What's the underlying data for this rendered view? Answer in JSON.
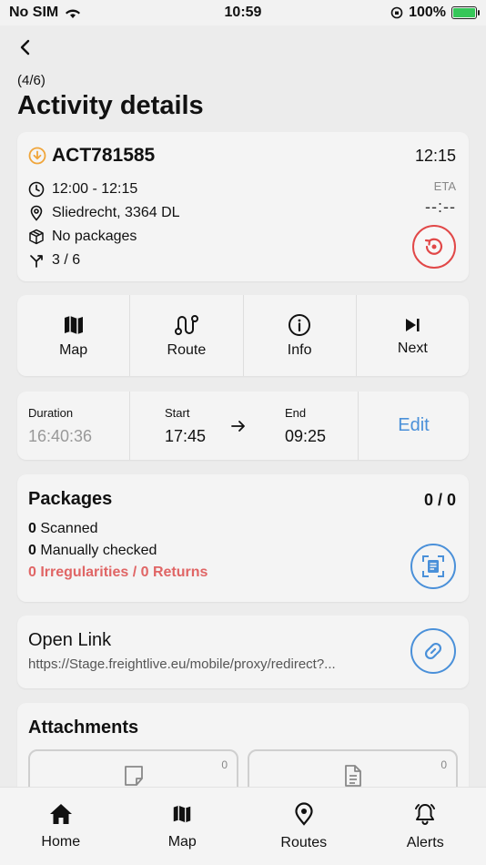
{
  "status": {
    "carrier": "No SIM",
    "time": "10:59",
    "battery": "100%",
    "battery_level": 1.0
  },
  "header": {
    "counter": "(4/6)",
    "title": "Activity details"
  },
  "activity": {
    "id": "ACT781585",
    "time": "12:15",
    "window": "12:00 - 12:15",
    "address": "Sliedrecht, 3364 DL",
    "packages": "No packages",
    "stops": "3 / 6",
    "eta_label": "ETA",
    "eta_value": "--:--"
  },
  "actions": [
    {
      "label": "Map",
      "icon": "map-icon"
    },
    {
      "label": "Route",
      "icon": "route-icon"
    },
    {
      "label": "Info",
      "icon": "info-icon"
    },
    {
      "label": "Next",
      "icon": "skip-next-icon"
    }
  ],
  "timing": {
    "duration_label": "Duration",
    "duration": "16:40:36",
    "start_label": "Start",
    "start": "17:45",
    "end_label": "End",
    "end": "09:25",
    "edit": "Edit"
  },
  "packages": {
    "title": "Packages",
    "count": "0 / 0",
    "scanned_num": "0",
    "scanned_label": "Scanned",
    "manual_num": "0",
    "manual_label": "Manually checked",
    "irregularities": "0 Irregularities / 0 Returns"
  },
  "link": {
    "title": "Open Link",
    "url": "https://Stage.freightlive.eu/mobile/proxy/redirect?..."
  },
  "attachments": {
    "title": "Attachments",
    "items": [
      {
        "count": "0"
      },
      {
        "count": "0"
      }
    ]
  },
  "tabs": [
    {
      "label": "Home",
      "icon": "home-icon"
    },
    {
      "label": "Map",
      "icon": "map-icon"
    },
    {
      "label": "Routes",
      "icon": "location-pin-icon"
    },
    {
      "label": "Alerts",
      "icon": "bell-icon"
    }
  ],
  "colors": {
    "accent": "#4a90d9",
    "danger": "#e14848",
    "warning": "#f0a53a"
  }
}
